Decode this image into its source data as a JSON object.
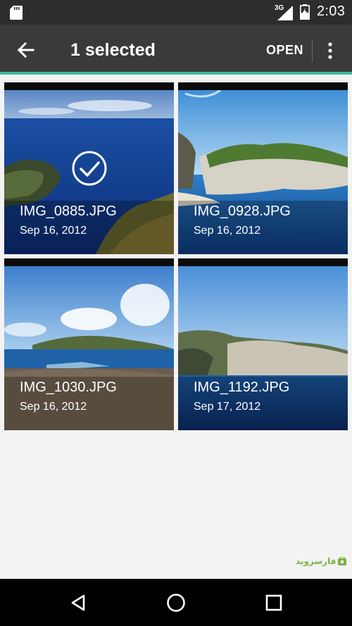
{
  "status_bar": {
    "time": "2:03",
    "network": "3G",
    "icons": [
      "sd-card-icon",
      "cell-signal-icon",
      "battery-charging-icon"
    ]
  },
  "action_bar": {
    "title": "1 selected",
    "open_label": "OPEN",
    "icons": [
      "back-arrow-icon",
      "overflow-menu-icon"
    ],
    "accent_color": "#3fb8a3"
  },
  "photos": [
    {
      "filename": "IMG_0885.JPG",
      "date": "Sep 16, 2012",
      "selected": true
    },
    {
      "filename": "IMG_0928.JPG",
      "date": "Sep 16, 2012",
      "selected": false
    },
    {
      "filename": "IMG_1030.JPG",
      "date": "Sep 16, 2012",
      "selected": false
    },
    {
      "filename": "IMG_1192.JPG",
      "date": "Sep 17, 2012",
      "selected": false
    }
  ],
  "watermark": {
    "text": "فارسروید"
  },
  "nav_bar": {
    "icons": [
      "back-triangle-icon",
      "home-circle-icon",
      "recents-square-icon"
    ]
  }
}
